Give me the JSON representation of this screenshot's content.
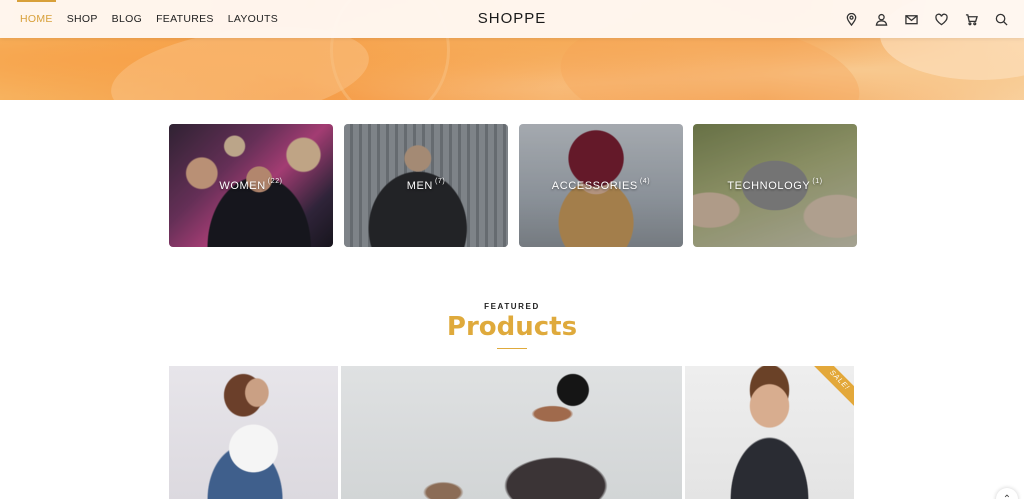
{
  "nav": {
    "links": [
      {
        "label": "HOME",
        "active": true
      },
      {
        "label": "SHOP",
        "active": false
      },
      {
        "label": "BLOG",
        "active": false
      },
      {
        "label": "FEATURES",
        "active": false
      },
      {
        "label": "LAYOUTS",
        "active": false
      }
    ],
    "logo": "SHOPPE",
    "icons": [
      "location-pin-icon",
      "user-icon",
      "mail-icon",
      "heart-icon",
      "cart-icon",
      "search-icon"
    ]
  },
  "categories": [
    {
      "name": "WOMEN",
      "count": "(22)"
    },
    {
      "name": "MEN",
      "count": "(7)"
    },
    {
      "name": "ACCESSORIES",
      "count": "(4)"
    },
    {
      "name": "TECHNOLOGY",
      "count": "(1)"
    }
  ],
  "featured": {
    "eyebrow": "FEATURED",
    "title": "Products"
  },
  "products": {
    "sale_label": "SALE!"
  },
  "colors": {
    "accent": "#dfaa3c",
    "nav_active": "#d8a03a"
  }
}
